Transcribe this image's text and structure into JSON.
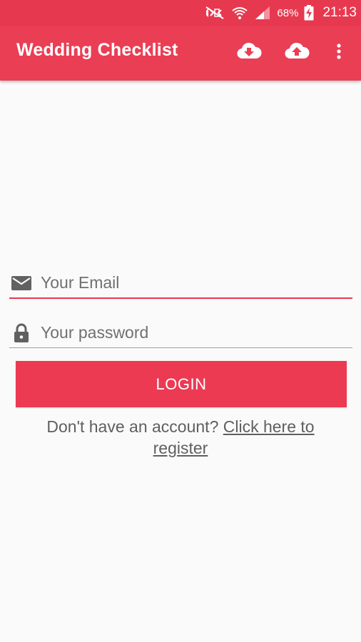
{
  "status_bar": {
    "battery_percent": "68%",
    "time": "21:13",
    "icons": [
      "mute-icon",
      "wifi-icon",
      "signal-icon",
      "battery-charging-icon"
    ]
  },
  "app_bar": {
    "title": "Wedding Checklist",
    "color": "#ea3e55",
    "actions": [
      "cloud-download-icon",
      "cloud-upload-icon",
      "more-vert-icon"
    ]
  },
  "form": {
    "email": {
      "value": "",
      "placeholder": "Your Email",
      "icon": "email-icon"
    },
    "password": {
      "value": "",
      "placeholder": "Your password",
      "icon": "lock-icon"
    },
    "login_label": "LOGIN",
    "register_prompt": "Don't have an account?",
    "register_link": "Click here to register"
  },
  "colors": {
    "accent": "#e63950",
    "background": "#fafafa",
    "text": "#5f5f5f"
  }
}
